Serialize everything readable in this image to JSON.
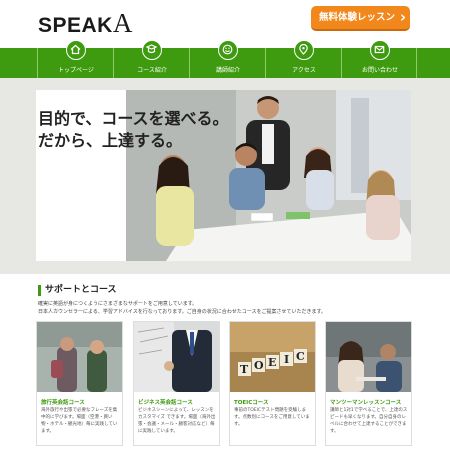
{
  "header": {
    "logo_prefix": "SPEAK",
    "logo_suffix": "A",
    "cta_label": "無料体験レッスン"
  },
  "nav": {
    "items": [
      {
        "label": "トップページ",
        "icon": "home-icon"
      },
      {
        "label": "コース紹介",
        "icon": "course-icon"
      },
      {
        "label": "講師紹介",
        "icon": "teacher-icon"
      },
      {
        "label": "アクセス",
        "icon": "map-pin-icon"
      },
      {
        "label": "お問い合わせ",
        "icon": "mail-icon"
      }
    ]
  },
  "hero": {
    "title_line1": "目的で、コースを選べる。",
    "title_line2": "だから、上達する。"
  },
  "support": {
    "title": "サポートとコース",
    "desc_line1": "確実に英語が身につくようにさまざまなサポートをご用意しています。",
    "desc_line2": "日本人カウンセラーによる、学習アドバイスを行なっております。ご自身の状況に合わせたコースをご提案させていただきます。"
  },
  "cards": [
    {
      "title": "旅行英会話コース",
      "text": "海外旅行や出張で必要なフレーズを集中的に学びます。場面（空港・買い物・ホテル・観光地）毎に実践しています。"
    },
    {
      "title": "ビジネス英会話コース",
      "text": "ビジネスシーンによって、レッスンを カスタマイズ できます。場面（海外出張・会議・メール・顧客対応など）毎に実践しています。"
    },
    {
      "title": "TOEICコース",
      "text": "事前のTOEICテスト問題を受験します。点数別にコースをご用意しています。"
    },
    {
      "title": "マンツーマンレッスンコース",
      "text": "講師と1対1で学べることで、上達のスピードも早くなります。自分自身のレベルに合わせて上達することができます。"
    }
  ],
  "colors": {
    "brand_green": "#3e9a0f",
    "cta_orange": "#f2871c"
  }
}
